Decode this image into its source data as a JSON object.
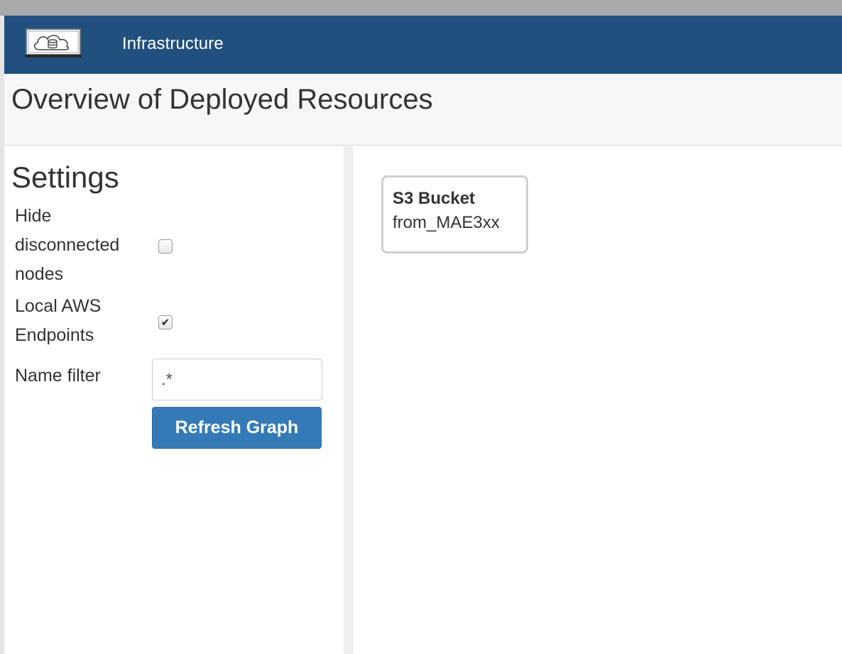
{
  "navbar": {
    "brand": "Infrastructure",
    "logo_icon": "cloud-database-icon",
    "color": "#21507f"
  },
  "header": {
    "title": "Overview of Deployed Resources"
  },
  "settings": {
    "title": "Settings",
    "hide_disconnected": {
      "label_lines": [
        "Hide",
        "disconnected",
        "nodes"
      ],
      "checked": false
    },
    "local_aws": {
      "label_lines": [
        "Local AWS",
        "Endpoints"
      ],
      "checked": true
    },
    "name_filter": {
      "label": "Name filter",
      "value": ".*"
    },
    "refresh_label": "Refresh Graph",
    "button_color": "#337ab7"
  },
  "graph": {
    "nodes": [
      {
        "type": "S3 Bucket",
        "name": "from_MAE3xx"
      }
    ]
  }
}
